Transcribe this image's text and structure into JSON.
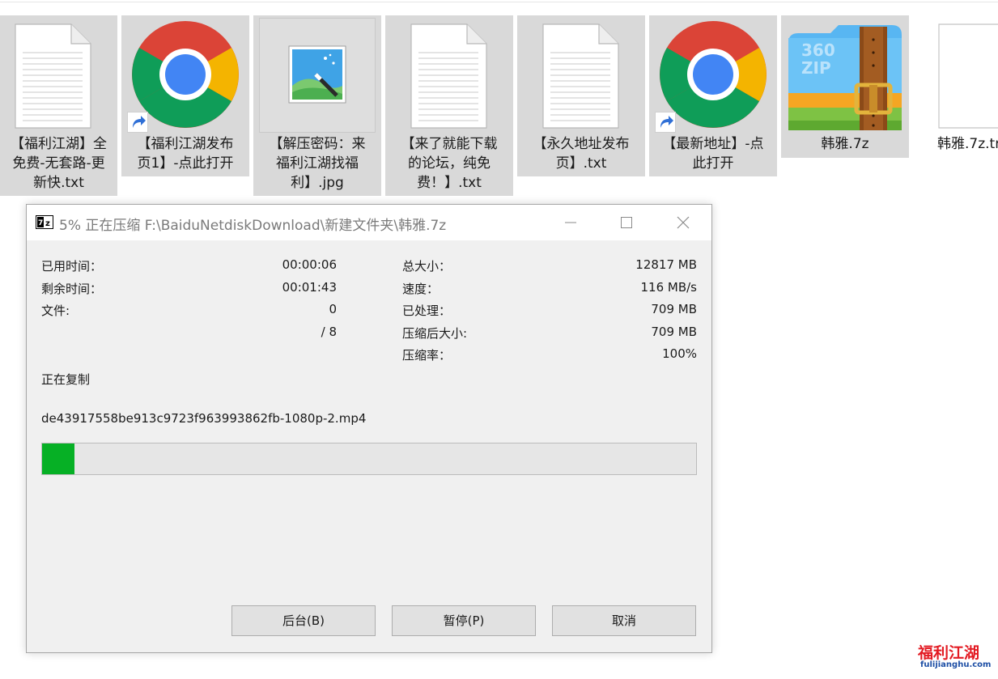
{
  "files": [
    {
      "name": "【福利江湖】全\n免费-无套路-更\n新快.txt",
      "icon": "text-document-icon"
    },
    {
      "name": "【福利江湖发布\n页1】-点此打开",
      "icon": "chrome-icon",
      "shortcut": true
    },
    {
      "name": "【解压密码：来\n福利江湖找福\n利】.jpg",
      "icon": "image-file-icon"
    },
    {
      "name": "【来了就能下载\n的论坛，纯免\n费！】.txt",
      "icon": "text-document-icon"
    },
    {
      "name": "【永久地址发布\n页】.txt",
      "icon": "text-document-icon"
    },
    {
      "name": "【最新地址】-点\n此打开",
      "icon": "chrome-icon",
      "shortcut": true
    },
    {
      "name": "韩雅.7z",
      "icon": "360zip-archive-icon",
      "icon_text": "360 ZIP"
    },
    {
      "name": "韩雅.7z.tr",
      "icon": "blank-file-icon"
    }
  ],
  "dialog": {
    "title": "5% 正在压缩 F:\\BaiduNetdiskDownload\\新建文件夹\\韩雅.7z",
    "app_icon_text": "7z",
    "left_stats": [
      {
        "label": "已用时间：",
        "value": "00:00:06"
      },
      {
        "label": "剩余时间：",
        "value": "00:01:43"
      },
      {
        "label": "文件:",
        "value": "0"
      },
      {
        "label": "",
        "value": "/ 8"
      }
    ],
    "right_stats": [
      {
        "label": "总大小：",
        "value": "12817 MB"
      },
      {
        "label": "速度：",
        "value": "116 MB/s"
      },
      {
        "label": "已处理：",
        "value": "709 MB"
      },
      {
        "label": "压缩后大小:",
        "value": "709 MB"
      },
      {
        "label": "压缩率：",
        "value": "100%"
      }
    ],
    "operation": "正在复制",
    "current_file": "de43917558be913c9723f963993862fb-1080p-2.mp4",
    "progress_fraction": 0.05,
    "progress_color": "#06b025",
    "buttons": {
      "background": "后台(B)",
      "pause": "暂停(P)",
      "cancel": "取消"
    }
  },
  "watermark": {
    "title": "福利江湖",
    "url": "fulijianghu.com"
  }
}
